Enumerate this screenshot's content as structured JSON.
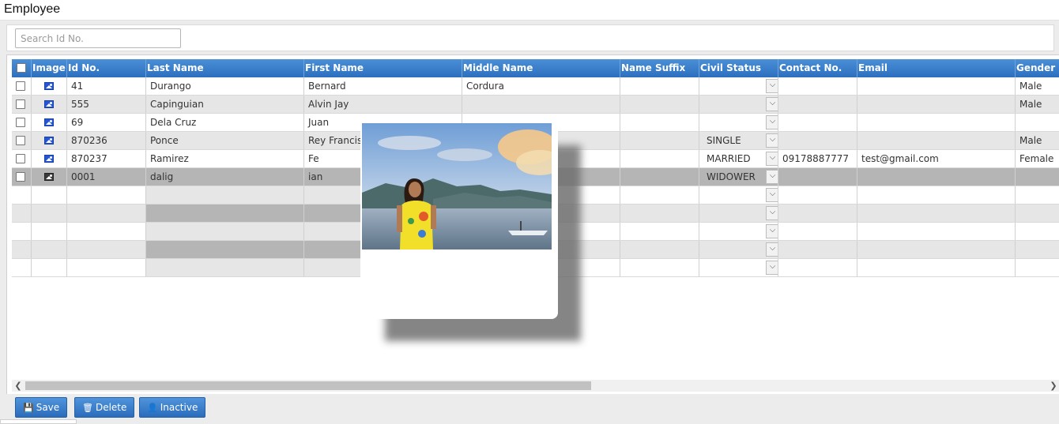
{
  "window": {
    "title": "Employee"
  },
  "search": {
    "placeholder": "Search Id No.",
    "value": ""
  },
  "grid": {
    "columns": [
      {
        "key": "select",
        "label": ""
      },
      {
        "key": "image",
        "label": "Image"
      },
      {
        "key": "id_no",
        "label": "Id No."
      },
      {
        "key": "last_name",
        "label": "Last Name"
      },
      {
        "key": "first_name",
        "label": "First Name"
      },
      {
        "key": "middle_name",
        "label": "Middle Name"
      },
      {
        "key": "name_suffix",
        "label": "Name Suffix"
      },
      {
        "key": "civil_status",
        "label": "Civil Status"
      },
      {
        "key": "contact_no",
        "label": "Contact No."
      },
      {
        "key": "email",
        "label": "Email"
      },
      {
        "key": "gender",
        "label": "Gender"
      }
    ],
    "rows": [
      {
        "id_no": "41",
        "last_name": "Durango",
        "first_name": "Bernard",
        "middle_name": "Cordura",
        "name_suffix": "",
        "civil_status": "",
        "contact_no": "",
        "email": "",
        "gender": "Male",
        "image_icon": "image-icon"
      },
      {
        "id_no": "555",
        "last_name": "Capinguian",
        "first_name": "Alvin Jay",
        "middle_name": "",
        "name_suffix": "",
        "civil_status": "",
        "contact_no": "",
        "email": "",
        "gender": "Male",
        "image_icon": "image-icon"
      },
      {
        "id_no": "69",
        "last_name": "Dela Cruz",
        "first_name": "Juan",
        "middle_name": "",
        "name_suffix": "",
        "civil_status": "",
        "contact_no": "",
        "email": "",
        "gender": "",
        "image_icon": "image-icon"
      },
      {
        "id_no": "870236",
        "last_name": "Ponce",
        "first_name": "Rey Francis",
        "middle_name": "",
        "name_suffix": "",
        "civil_status": "SINGLE",
        "contact_no": "",
        "email": "",
        "gender": "Male",
        "image_icon": "image-icon"
      },
      {
        "id_no": "870237",
        "last_name": "Ramirez",
        "first_name": "Fe",
        "middle_name": "",
        "name_suffix": "",
        "civil_status": "MARRIED",
        "contact_no": "09178887777",
        "email": "test@gmail.com",
        "gender": "Female",
        "image_icon": "image-icon"
      },
      {
        "id_no": "0001",
        "last_name": "dalig",
        "first_name": "ian",
        "middle_name": "",
        "name_suffix": "",
        "civil_status": "WIDOWER",
        "contact_no": "",
        "email": "",
        "gender": "",
        "image_icon": "image-icon",
        "selected": true
      }
    ],
    "empty_rows": 5
  },
  "buttons": {
    "save": {
      "label": "Save",
      "icon": "save-icon"
    },
    "delete": {
      "label": "Delete",
      "icon": "trash-icon"
    },
    "inactive": {
      "label": "Inactive",
      "icon": "user-icon"
    }
  },
  "popup": {
    "content": "employee-photo"
  },
  "colors": {
    "header_blue": "#2d6fbd",
    "button_blue": "#3a7dca",
    "selected_row": "#b5b5b5",
    "alt_row": "#e6e6e6"
  }
}
